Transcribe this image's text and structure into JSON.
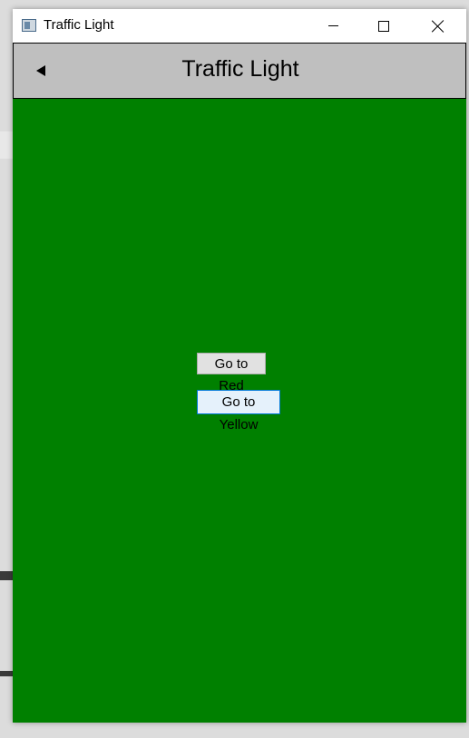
{
  "window": {
    "title": "Traffic Light"
  },
  "navbar": {
    "title": "Traffic Light"
  },
  "content": {
    "background_color": "#008000",
    "buttons": [
      {
        "label": "Go to Red"
      },
      {
        "label": "Go to Yellow"
      }
    ]
  },
  "icons": {
    "app": "app-window-icon",
    "minimize": "minimize-icon",
    "maximize": "maximize-icon",
    "close": "close-icon",
    "back": "back-arrow-icon"
  }
}
